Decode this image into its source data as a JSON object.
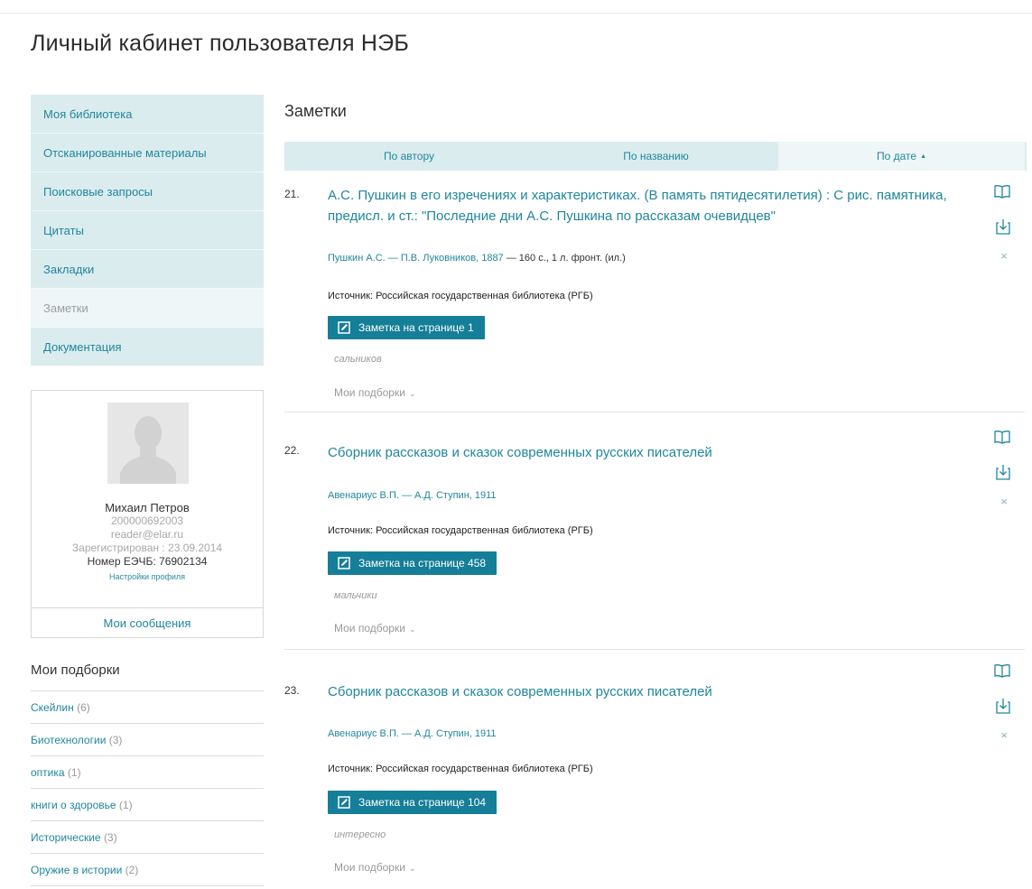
{
  "page": {
    "title": "Личный кабинет пользователя НЭБ"
  },
  "sidebar": {
    "items": [
      {
        "label": "Моя библиотека",
        "active": false
      },
      {
        "label": "Отсканированные материалы",
        "active": false
      },
      {
        "label": "Поисковые запросы",
        "active": false
      },
      {
        "label": "Цитаты",
        "active": false
      },
      {
        "label": "Закладки",
        "active": false
      },
      {
        "label": "Заметки",
        "active": true
      },
      {
        "label": "Документация",
        "active": false
      }
    ]
  },
  "profile": {
    "name": "Михаил Петров",
    "id": "200000692003",
    "email": "reader@elar.ru",
    "registered": "Зарегистрирован : 23.09.2014",
    "card_number": "Номер ЕЭЧБ: 76902134",
    "settings_link": "Настройки профиля",
    "messages_button": "Мои сообщения"
  },
  "collections": {
    "title": "Мои подборки",
    "items": [
      {
        "name": "Скейлин",
        "count": "(6)"
      },
      {
        "name": "Биотехнологии",
        "count": "(3)"
      },
      {
        "name": "оптика",
        "count": "(1)"
      },
      {
        "name": "книги о здоровье",
        "count": "(1)"
      },
      {
        "name": "Исторические",
        "count": "(3)"
      },
      {
        "name": "Оружие в истории",
        "count": "(2)"
      }
    ]
  },
  "main": {
    "title": "Заметки",
    "sort": {
      "by_author": "По автору",
      "by_title": "По названию",
      "by_date": "По дате",
      "active": "by_date",
      "direction_icon": "▲"
    },
    "entries": [
      {
        "number": "21.",
        "title": "А.С. Пушкин в его изречениях и характеристиках. (В память пятидесятилетия) : С рис. памятника, предисл. и ст.: \"Последние дни А.С. Пушкина по рассказам очевидцев\"",
        "meta_link": "Пушкин А.С. — П.В. Луковников, 1887",
        "meta_rest": " — 160 с., 1 л. фронт. (ил.)",
        "source": "Источник: Российская государственная библиотека (РГБ)",
        "note_button": "Заметка на странице 1",
        "note": "сальников",
        "collections_label": "Мои подборки"
      },
      {
        "number": "22.",
        "title": "Сборник рассказов и сказок современных русских писателей",
        "meta_link": "Авенариус В.П. — А.Д. Ступин, 1911",
        "meta_rest": "",
        "source": "Источник: Российская государственная библиотека (РГБ)",
        "note_button": "Заметка на странице 458",
        "note": "мальчики",
        "collections_label": "Мои подборки"
      },
      {
        "number": "23.",
        "title": "Сборник рассказов и сказок современных русских писателей",
        "meta_link": "Авенариус В.П. — А.Д. Ступин, 1911",
        "meta_rest": "",
        "source": "Источник: Российская государственная библиотека (РГБ)",
        "note_button": "Заметка на странице 104",
        "note": "интересно",
        "collections_label": "Мои подборки"
      }
    ]
  },
  "icons": {
    "read": "book-icon",
    "download": "download-icon",
    "remove": "close-icon",
    "note": "edit-note-icon",
    "chevron": "chevron-down-icon",
    "remove_glyph": "×",
    "chevron_glyph": "⌄"
  },
  "colors": {
    "accent": "#20869d",
    "button": "#157e98",
    "menu_bg": "#dbecef",
    "menu_active_bg": "#eef6f7"
  }
}
